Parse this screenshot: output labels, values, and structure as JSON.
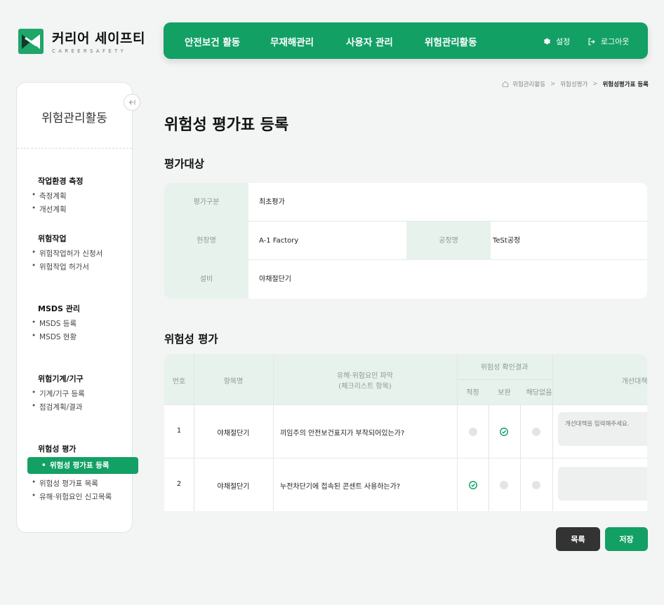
{
  "brand": {
    "name": "커리어 세이프티",
    "sub": "CAREERSAFETY",
    "color": "#12a065"
  },
  "topnav": {
    "items": [
      "안전보건 활동",
      "무재해관리",
      "사용자 관리",
      "위험관리활동"
    ],
    "settings": "설정",
    "logout": "로그아웃"
  },
  "breadcrumb": [
    "위험관리활동",
    "위험성평가",
    "위험성평가표 등록"
  ],
  "sidebar": {
    "title": "위험관리활동",
    "groups": [
      {
        "title": "작업환경 측정",
        "items": [
          "측정계획",
          "개선계획"
        ]
      },
      {
        "title": "위험작업",
        "items": [
          "위험작업허가 신청서",
          "위험작업 허가서"
        ]
      },
      {
        "title": "MSDS 관리",
        "items": [
          "MSDS 등록",
          "MSDS 현황"
        ]
      },
      {
        "title": "위험기계/기구",
        "items": [
          "기계/기구 등록",
          "점검계획/결과"
        ]
      },
      {
        "title": "위험성 평가",
        "items": [
          "위험성 평가표 등록",
          "위험성 평가표 목록",
          "유해·위험요인 신고목록"
        ]
      }
    ]
  },
  "page": {
    "title": "위험성 평가표 등록",
    "section1": "평가대상",
    "section2": "위험성 평가"
  },
  "target": {
    "eval_type_label": "평가구분",
    "eval_type_value": "최초평가",
    "site_label": "현장명",
    "site_value": "A-1 Factory",
    "process_label": "공정명",
    "process_value": "TeSt공정",
    "equipment_label": "설비",
    "equipment_value": "야채절단기"
  },
  "table": {
    "headers": {
      "no": "번호",
      "item": "항목명",
      "hazard": "유해·위험요인 파악",
      "hazard_sub": "(체크리스트 항목)",
      "result": "위험성 확인결과",
      "result_ok": "적정",
      "result_fix": "보완",
      "result_na": "해당없음",
      "improve": "개선대책"
    },
    "rows": [
      {
        "no": "1",
        "item": "야채절단기",
        "hazard": "끼임주의 안전보건표지가 부착되어있는가?",
        "result": "보완",
        "improve": "",
        "placeholder": "개선대책을 입력해주세요."
      },
      {
        "no": "2",
        "item": "야채절단기",
        "hazard": "누전차단기에 접속된 콘센트 사용하는가?",
        "result": "적정",
        "improve": "",
        "placeholder": ""
      }
    ]
  },
  "buttons": {
    "list": "목록",
    "save": "저장"
  }
}
